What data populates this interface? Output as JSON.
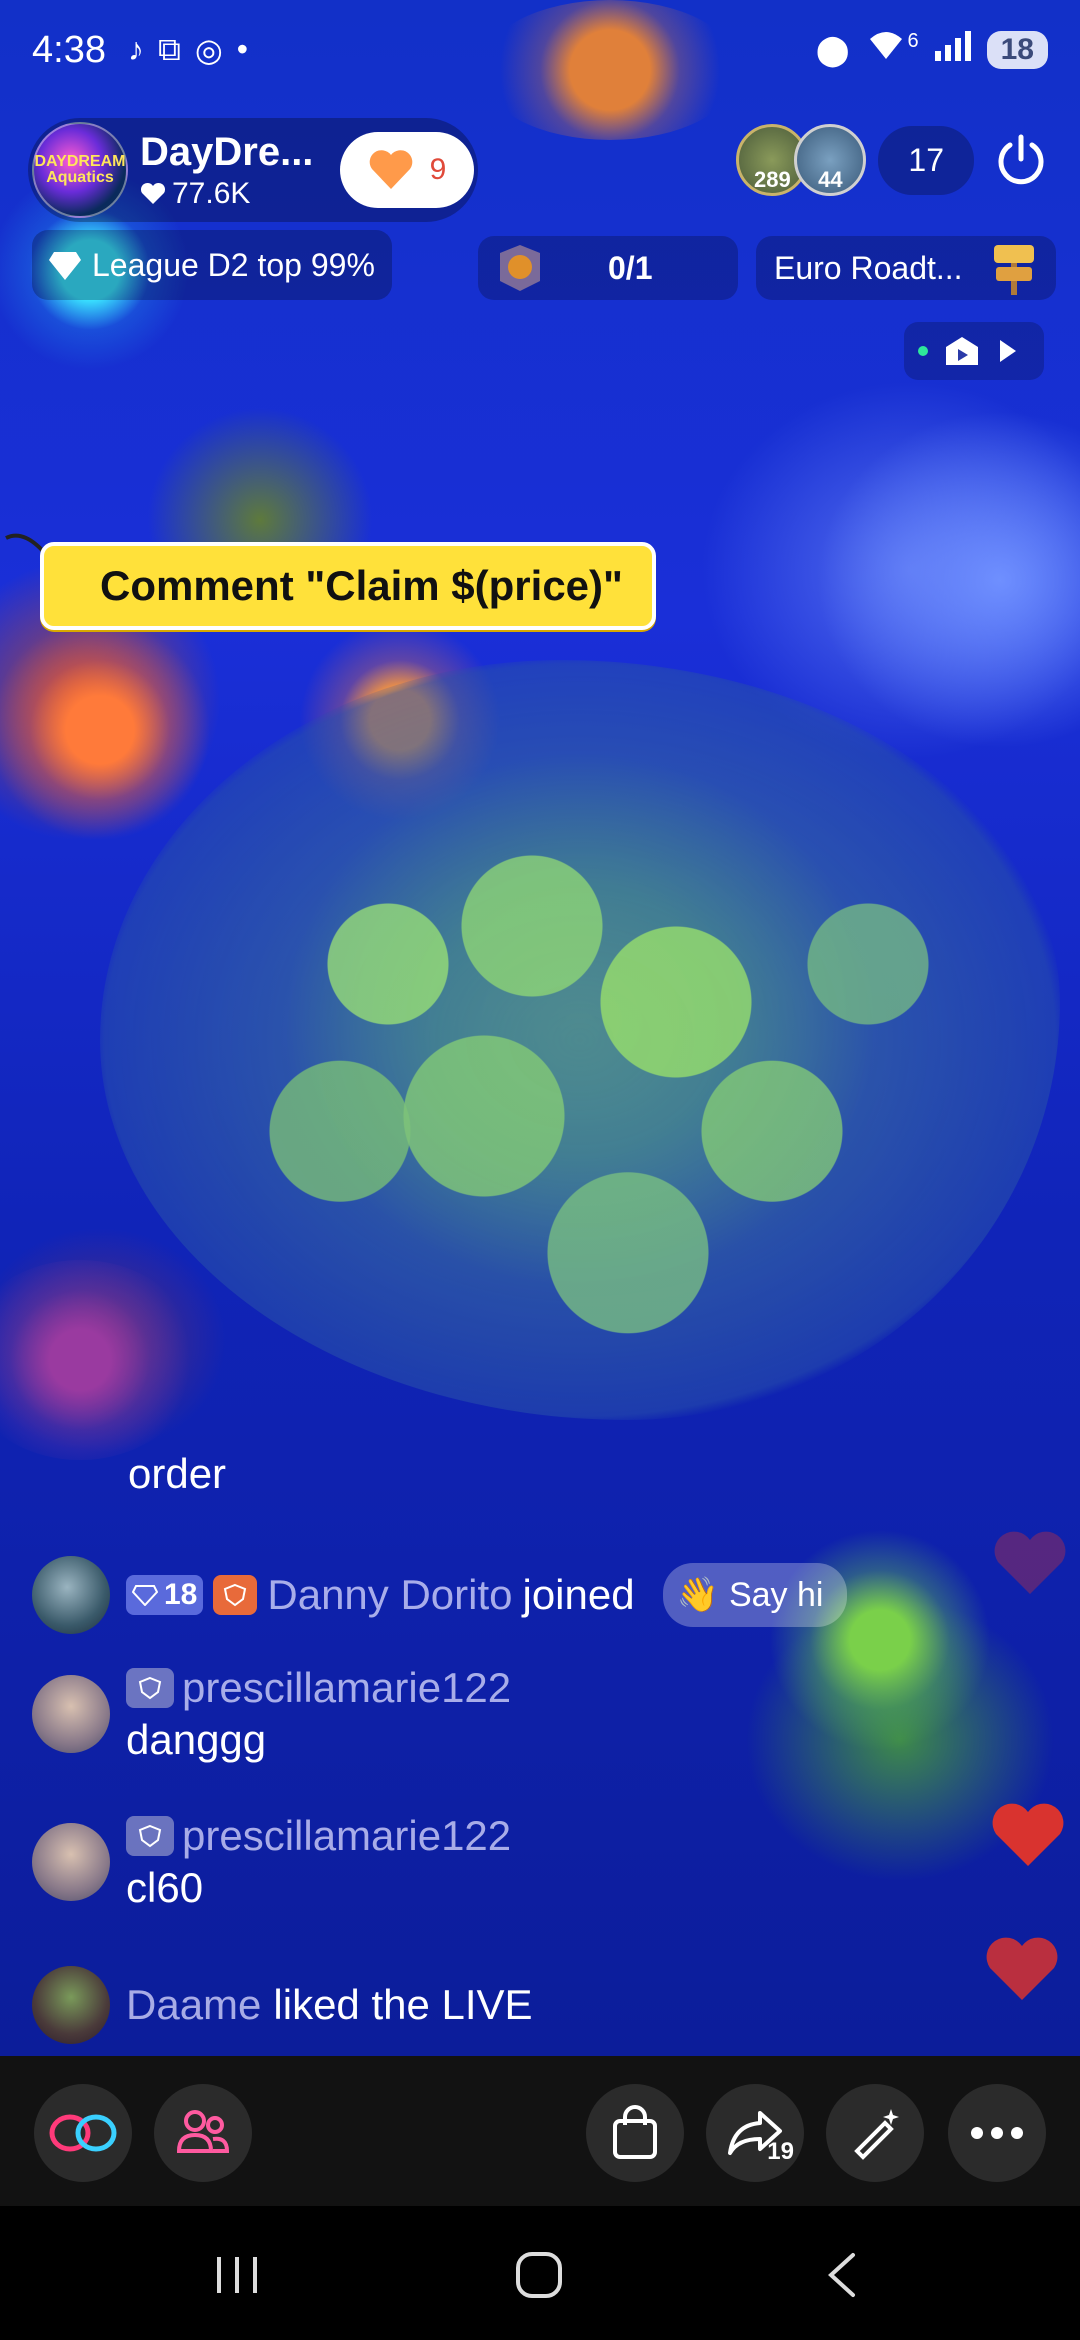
{
  "status_bar": {
    "time": "4:38",
    "network": "6",
    "battery": "18"
  },
  "host": {
    "name": "DayDre...",
    "likes": "77.6K",
    "logo_text": "DAYDREAM Aquatics",
    "follow_count": "9"
  },
  "viewers": {
    "top1_badge": "289",
    "top2_badge": "44",
    "count": "17"
  },
  "league": {
    "label": "League D2 top 99%"
  },
  "task": {
    "progress": "0/1"
  },
  "road": {
    "label": "Euro Roadt..."
  },
  "claim_banner": {
    "text": "Comment \"Claim $(price)\""
  },
  "chat": [
    {
      "type": "text",
      "body": "order"
    },
    {
      "type": "join",
      "level": "18",
      "username": "Danny Dorito",
      "action": "joined",
      "say_hi": "Say hi"
    },
    {
      "type": "message",
      "username": "prescillamarie122",
      "body": "danggg"
    },
    {
      "type": "message",
      "username": "prescillamarie122",
      "body": "cl60"
    },
    {
      "type": "like",
      "username": "Daame",
      "action": "liked the LIVE"
    }
  ],
  "toolbar": {
    "share_count": "19"
  },
  "colors": {
    "accent_red": "#e04a3a",
    "banner_yellow": "#ffe13a",
    "heart_red": "#d9332f"
  }
}
